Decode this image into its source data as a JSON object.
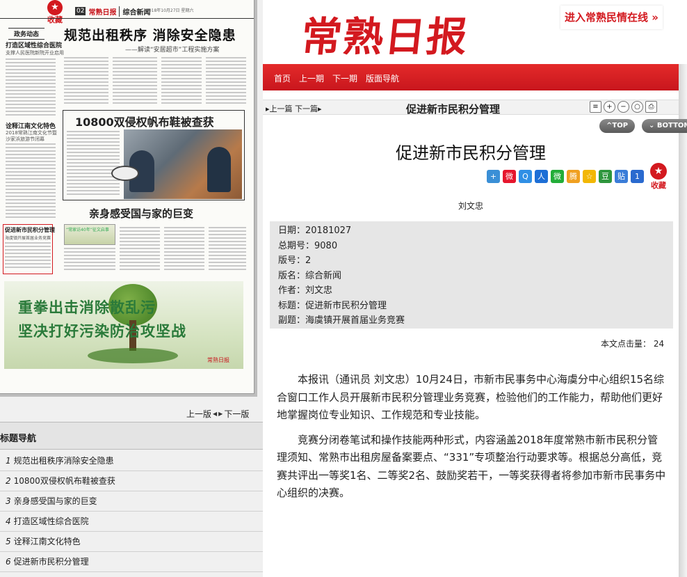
{
  "left": {
    "collect_label": "收藏",
    "collect_star": "★",
    "paper": {
      "page_num": "02",
      "logo": "常熟日报",
      "section": "综合新闻",
      "date": "2018年10月27日 星期六",
      "headline": "规范出租秩序  消除安全隐患",
      "headline_sub": "——解读“安居超市”工程实施方案",
      "tag": "政务动态",
      "left_head1": "打造区域性综合医院",
      "left_sub1": "支撑人民医院新院开业启用",
      "left_head2": "诠释江南文化特色",
      "left_sub2": "2018常熟江南文化节暨",
      "left_sub3": "沙家浜旅游节闭幕",
      "box_head": "10800双侵权帆布鞋被查获",
      "h3": "亲身感受国与家的巨变",
      "red_head": "促进新市民积分管理",
      "red_sub": "海虞镇开展首届业务竞赛",
      "strip": "“常家访40年”征文启事",
      "ad_line1": "重拳出击消除散乱污",
      "ad_line2": "坚决打好污染防治攻坚战",
      "ad_logo": "常熟日报"
    },
    "pager": {
      "prev": "上一版",
      "next": "下一版"
    },
    "nav_title": "标题导航",
    "nav_items": [
      {
        "num": "1",
        "label": "规范出租秩序消除安全隐患"
      },
      {
        "num": "2",
        "label": "10800双侵权帆布鞋被查获"
      },
      {
        "num": "3",
        "label": "亲身感受国与家的巨变"
      },
      {
        "num": "4",
        "label": "打造区域性综合医院"
      },
      {
        "num": "5",
        "label": "诠释江南文化特色"
      },
      {
        "num": "6",
        "label": "促进新市民积分管理"
      }
    ]
  },
  "header": {
    "logo": "常熟日报",
    "promo": "进入常熟民情在线",
    "promo_arrows": "»",
    "nav": [
      "首页",
      "上一期",
      "下一期",
      "版面导航"
    ]
  },
  "toolbar": {
    "prev": "上一篇",
    "next": "下一篇",
    "title": "促进新市民积分管理",
    "icons": [
      "document-icon",
      "zoom-in-icon",
      "zoom-out-icon",
      "zoom-reset-icon",
      "print-icon"
    ],
    "top_btn": "^TOP",
    "bottom_btn": "BOTTOM"
  },
  "article": {
    "title": "促进新市民积分管理",
    "share_icons": [
      "plus-share-icon",
      "weibo-icon",
      "qzone-icon",
      "renren-icon",
      "wechat-icon",
      "tencent-weibo-icon",
      "favorite-icon",
      "douban-icon",
      "tieba-icon",
      "one-icon"
    ],
    "collect_label": "收藏",
    "author": "刘文忠",
    "meta": [
      {
        "key": "日期：",
        "value": "20181027"
      },
      {
        "key": "总期号：",
        "value": "9080"
      },
      {
        "key": "版号：",
        "value": "2"
      },
      {
        "key": "版名：",
        "value": "综合新闻"
      },
      {
        "key": "作者：",
        "value": "刘文忠"
      },
      {
        "key": "标题：",
        "value": "促进新市民积分管理"
      },
      {
        "key": "副题：",
        "value": "海虞镇开展首届业务竞赛"
      }
    ],
    "hits_label": "本文点击量：",
    "hits_value": "24",
    "paragraphs": [
      "本报讯（通讯员 刘文忠）10月24日，市新市民事务中心海虞分中心组织15名综合窗口工作人员开展新市民积分管理业务竞赛，检验他们的工作能力，帮助他们更好地掌握岗位专业知识、工作规范和专业技能。",
      "竞赛分闭卷笔试和操作技能两种形式，内容涵盖2018年度常熟市新市民积分管理须知、常熟市出租房屋备案要点、“331”专项整治行动要求等。根据总分高低，竞赛共评出一等奖1名、二等奖2名、鼓励奖若干，一等奖获得者将参加市新市民事务中心组织的决赛。"
    ]
  },
  "colors": {
    "brand_red": "#d3191f",
    "meta_bg": "#e6e6e6"
  }
}
